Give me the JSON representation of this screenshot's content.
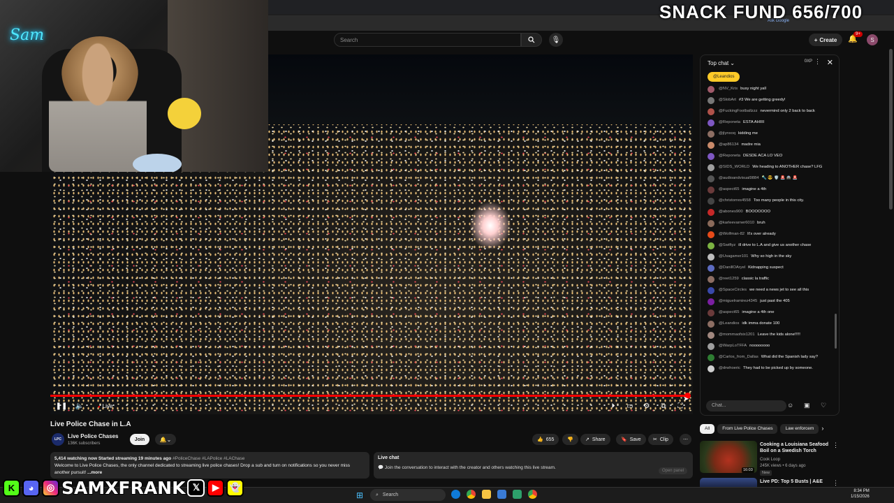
{
  "overlay": {
    "snack_fund": "SNACK FUND 656/700",
    "neon_sign": "Sam",
    "social_handle": "SAMXFRANK",
    "social_icons": [
      "kick-icon",
      "discord-icon",
      "instagram-icon",
      "x-icon",
      "youtube-icon",
      "snapchat-icon"
    ]
  },
  "youtube": {
    "search_placeholder": "Search",
    "create_label": "Create",
    "notif_count": "9+",
    "avatar_letter": "S",
    "ask_google": "Ask Google"
  },
  "player": {
    "live_label": "Live",
    "progress": 0.991
  },
  "video": {
    "title": "Live Police Chase in L.A",
    "channel_logo": "LPC",
    "channel_name": "Live Police Chases",
    "subscribers": "136K subscribers",
    "join_label": "Join",
    "likes": "655",
    "share_label": "Share",
    "save_label": "Save",
    "clip_label": "Clip"
  },
  "description": {
    "stats": "5,414 watching now  Started streaming 19 minutes ago",
    "hashtags": "#PoliceChase #LAPolice #LAChase",
    "text": "Welcome to Live Police Chases, the only channel dedicated to streaming live police chases! Drop a sub and turn on notifications so you never miss another pursuit!",
    "more": "...more"
  },
  "live_chat_box": {
    "title": "Live chat",
    "subtitle": "Join the conversation to interact with the creator and others watching this live stream.",
    "open_panel": "Open panel"
  },
  "chat": {
    "header": "Top chat",
    "points": "0XP",
    "pinned": "@Leandios",
    "input_placeholder": "Chat...",
    "messages": [
      {
        "author": "@NV_Kris",
        "text": "busy night yall",
        "color": "#a05a6a"
      },
      {
        "author": "@SlobArt",
        "text": "#3  We are getting greedy!",
        "color": "#777777"
      },
      {
        "author": "@FuckingFootballzzz",
        "text": "nevermind only 2 back to back",
        "color": "#b0524a"
      },
      {
        "author": "@Reponeta",
        "text": "ESTA AHIIII",
        "color": "#7e57c2"
      },
      {
        "author": "@jlynxoq",
        "text": "kidding me",
        "color": "#8d6e63"
      },
      {
        "author": "@ap86134",
        "text": "madre mia",
        "color": "#c98a6a"
      },
      {
        "author": "@Reponeta",
        "text": "DESDE ACA LO VEO",
        "color": "#7e57c2"
      },
      {
        "author": "@SIDS_WORLD",
        "text": "We heading to ANOTHER chase? LFG",
        "color": "#9e9e9e"
      },
      {
        "author": "@audioandvisual9884",
        "text": "🔦 😎 🛡️ 🚨 🚔 🚨",
        "color": "#555555"
      },
      {
        "author": "@aspect65",
        "text": "imagine a 4th",
        "color": "#6a3a3a"
      },
      {
        "author": "@christorres4558",
        "text": "Too many people in this city.",
        "color": "#444444"
      },
      {
        "author": "@abones900",
        "text": "BOOOOOOO",
        "color": "#c62828"
      },
      {
        "author": "@karleevarner6010",
        "text": "bruh",
        "color": "#8a6a5a"
      },
      {
        "author": "@Wolfman-82",
        "text": "It's over already",
        "color": "#e64a19"
      },
      {
        "author": "@Swiftyz",
        "text": "ill drive to L.A and give us another chase",
        "color": "#7cb342"
      },
      {
        "author": "@Usagamer101",
        "text": "Why so high in the sky",
        "color": "#bdbdbd"
      },
      {
        "author": "@DanillOAryel",
        "text": "Kidnapping suspect",
        "color": "#5c6bc0"
      },
      {
        "author": "@reet1259",
        "text": "classic la traffic",
        "color": "#8d6e63"
      },
      {
        "author": "@SpaceCircles",
        "text": "we need a news jet to see all this",
        "color": "#3949ab"
      },
      {
        "author": "@miguelramirez4345",
        "text": "just past the 405",
        "color": "#7b1fa2"
      },
      {
        "author": "@aspect65",
        "text": "imagine a 4th one",
        "color": "#6a3a3a"
      },
      {
        "author": "@Leandios",
        "text": "idk imma donate 100",
        "color": "#8d6e63"
      },
      {
        "author": "@mommaofsix1201",
        "text": "Leave the kids alone!!!!!",
        "color": "#a1887f"
      },
      {
        "author": "@WarpLoTFFA",
        "text": "noooooooo",
        "color": "#9e9e9e"
      },
      {
        "author": "@Carlos_from_Dallas",
        "text": "What did the Spanish lady say?",
        "color": "#2e7d32"
      },
      {
        "author": "@drwhoeric",
        "text": "They had to be picked up by someone.",
        "color": "#cfcfcf"
      }
    ]
  },
  "recommendations": {
    "chips": [
      "All",
      "From Live Police Chases",
      "Law enforcem"
    ],
    "items": [
      {
        "title": "Cooking a Louisiana Seafood Boil on a Swedish Torch",
        "channel": "Cook Loop",
        "meta": "245K views • 6 days ago",
        "badge": "New",
        "duration": "16:03"
      },
      {
        "title": "Live PD: Top 5 Busts | A&E"
      }
    ]
  },
  "taskbar": {
    "search_label": "Search",
    "time": "8:34 PM",
    "date": "1/15/2026"
  }
}
